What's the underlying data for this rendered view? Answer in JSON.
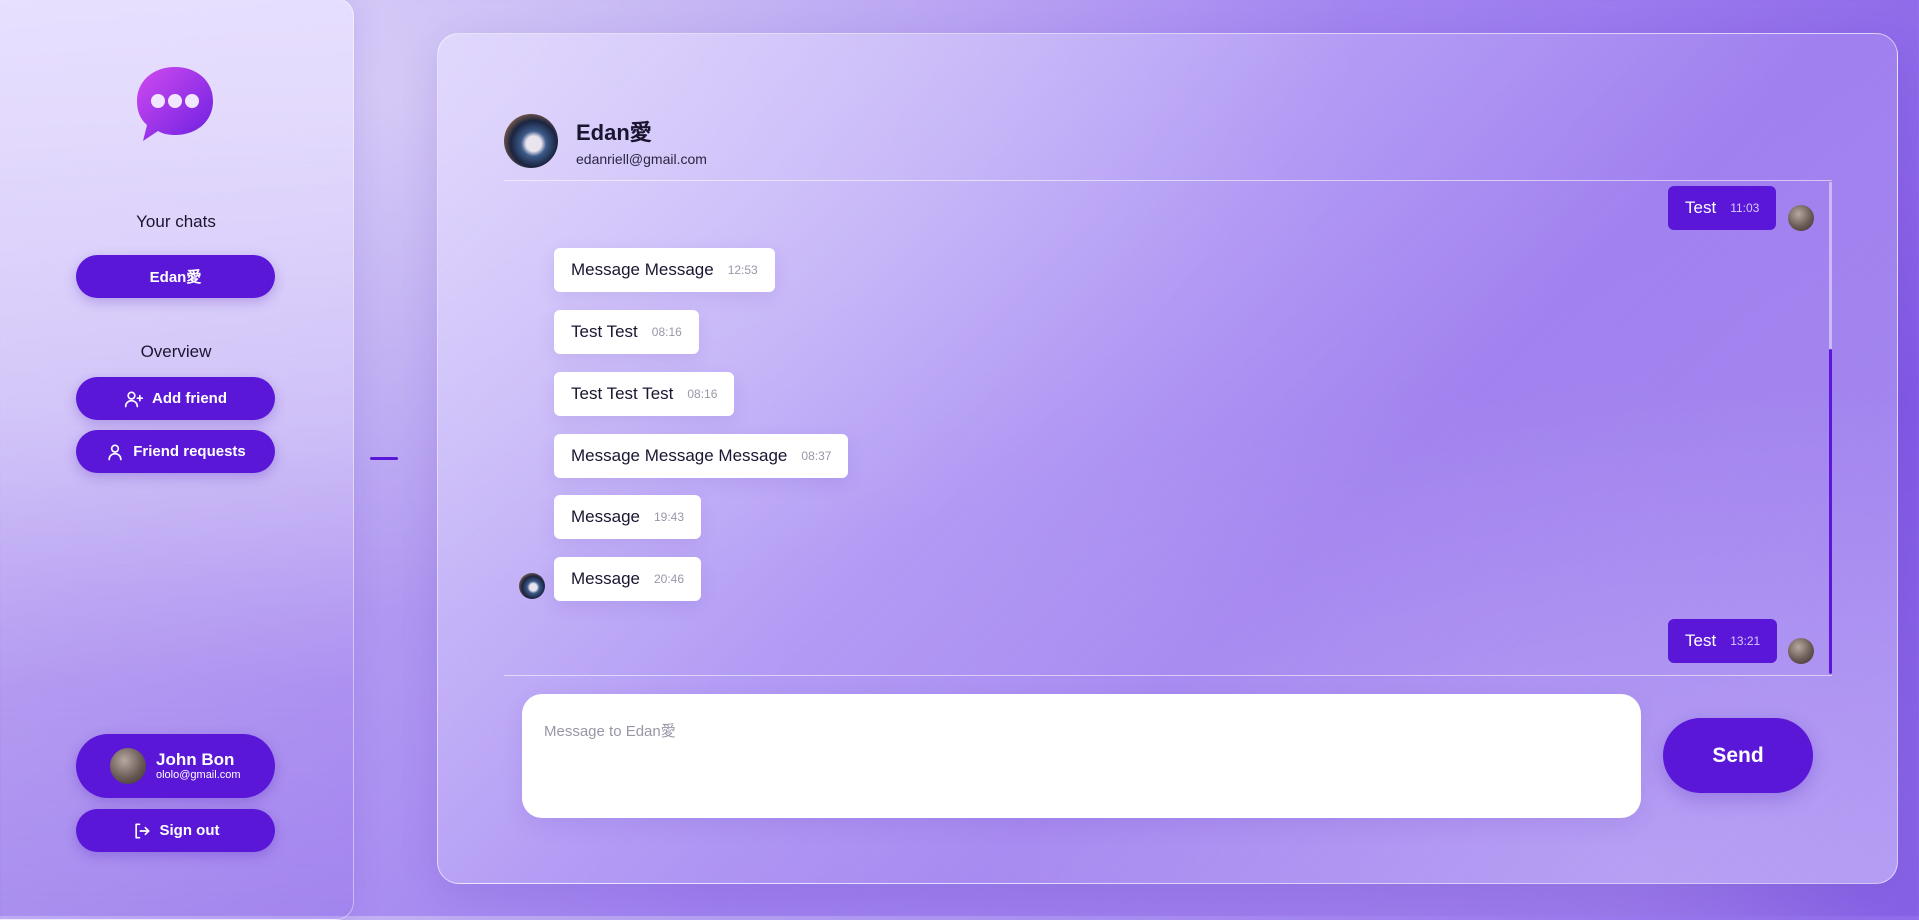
{
  "sidebar": {
    "chats_heading": "Your chats",
    "chats": [
      {
        "label": "Edan愛"
      }
    ],
    "overview_heading": "Overview",
    "add_friend_label": "Add friend",
    "friend_requests_label": "Friend requests",
    "user": {
      "name": "John Bon",
      "email": "ololo@gmail.com"
    },
    "sign_out_label": "Sign out"
  },
  "chat": {
    "contact": {
      "name": "Edan愛",
      "email": "edanriell@gmail.com"
    },
    "messages": [
      {
        "direction": "out",
        "text": "Test",
        "time": "11:03"
      },
      {
        "direction": "in",
        "text": "Message Message",
        "time": "12:53"
      },
      {
        "direction": "in",
        "text": "Test Test",
        "time": "08:16"
      },
      {
        "direction": "in",
        "text": "Test Test Test",
        "time": "08:16"
      },
      {
        "direction": "in",
        "text": "Message Message Message",
        "time": "08:37"
      },
      {
        "direction": "in",
        "text": "Message",
        "time": "19:43"
      },
      {
        "direction": "in",
        "text": "Message",
        "time": "20:46"
      },
      {
        "direction": "out",
        "text": "Test",
        "time": "13:21"
      }
    ],
    "composer_placeholder": "Message to Edan愛",
    "send_label": "Send"
  },
  "colors": {
    "accent": "#5a17d8",
    "bubble_in": "#ffffff"
  },
  "icons": [
    "chat-bubble-logo-icon",
    "user-plus-icon",
    "user-icon",
    "sign-out-icon"
  ]
}
